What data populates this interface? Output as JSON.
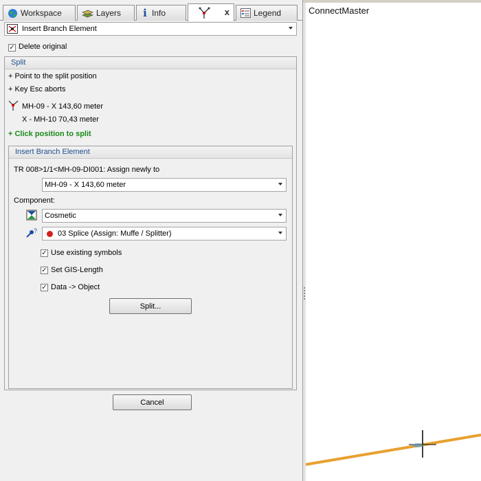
{
  "tabs": [
    {
      "label": "Workspace",
      "icon": "globe-icon"
    },
    {
      "label": "Layers",
      "icon": "layers-icon"
    },
    {
      "label": "Info",
      "icon": "info-icon"
    },
    {
      "label": "",
      "icon": "split-tool-icon",
      "close": "x"
    },
    {
      "label": "Legend",
      "icon": "legend-icon"
    }
  ],
  "tool_select": {
    "value": "Insert Branch Element"
  },
  "delete_original": {
    "label": "Delete original",
    "checked": true
  },
  "split": {
    "header": "Split",
    "hint1": "+ Point to the split position",
    "hint2": "+ Key Esc aborts",
    "segment1": "MH-09 - X  143,60 meter",
    "segment2": "X - MH-10  70,43 meter",
    "action": "+ Click position to split"
  },
  "insert_branch": {
    "header": "Insert Branch Element",
    "assign_label": "TR 008>1/1<MH-09-DI001: Assign newly to",
    "assign_value": "MH-09 - X  143,60 meter",
    "component_label": "Component:",
    "component_value": "Cosmetic",
    "splice_value": "03 Splice (Assign: Muffe / Splitter)",
    "options": [
      {
        "label": "Use existing symbols",
        "checked": true
      },
      {
        "label": "Set GIS-Length",
        "checked": true
      },
      {
        "label": "Data -> Object",
        "checked": true
      }
    ],
    "split_button": "Split..."
  },
  "cancel_button": "Cancel",
  "map": {
    "title": "ConnectMaster",
    "line_color": "#e8a030"
  }
}
